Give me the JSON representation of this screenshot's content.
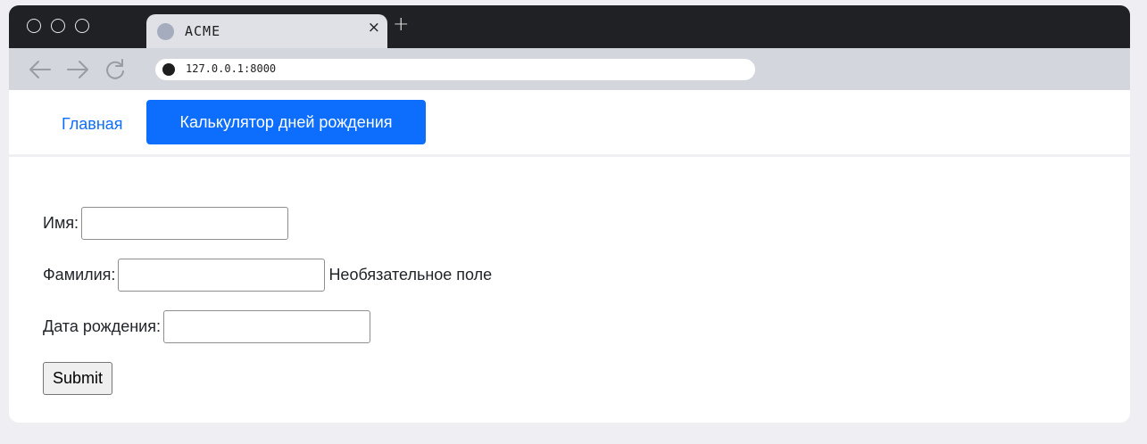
{
  "browser": {
    "tab_title": "ACME",
    "tab_close": "×",
    "new_tab": "+",
    "url": "127.0.0.1:8000"
  },
  "navbar": {
    "home_link": "Главная",
    "active_item": "Калькулятор дней рождения"
  },
  "form": {
    "first_name": {
      "label": "Имя:",
      "value": ""
    },
    "last_name": {
      "label": "Фамилия:",
      "value": "",
      "hint": "Необязательное поле"
    },
    "birth_date": {
      "label": "Дата рождения:",
      "value": ""
    },
    "submit_label": "Submit"
  },
  "colors": {
    "accent": "#0d6efd",
    "titlebar": "#202124",
    "toolbar": "#d4d6dd",
    "page_background": "#efeff3"
  }
}
